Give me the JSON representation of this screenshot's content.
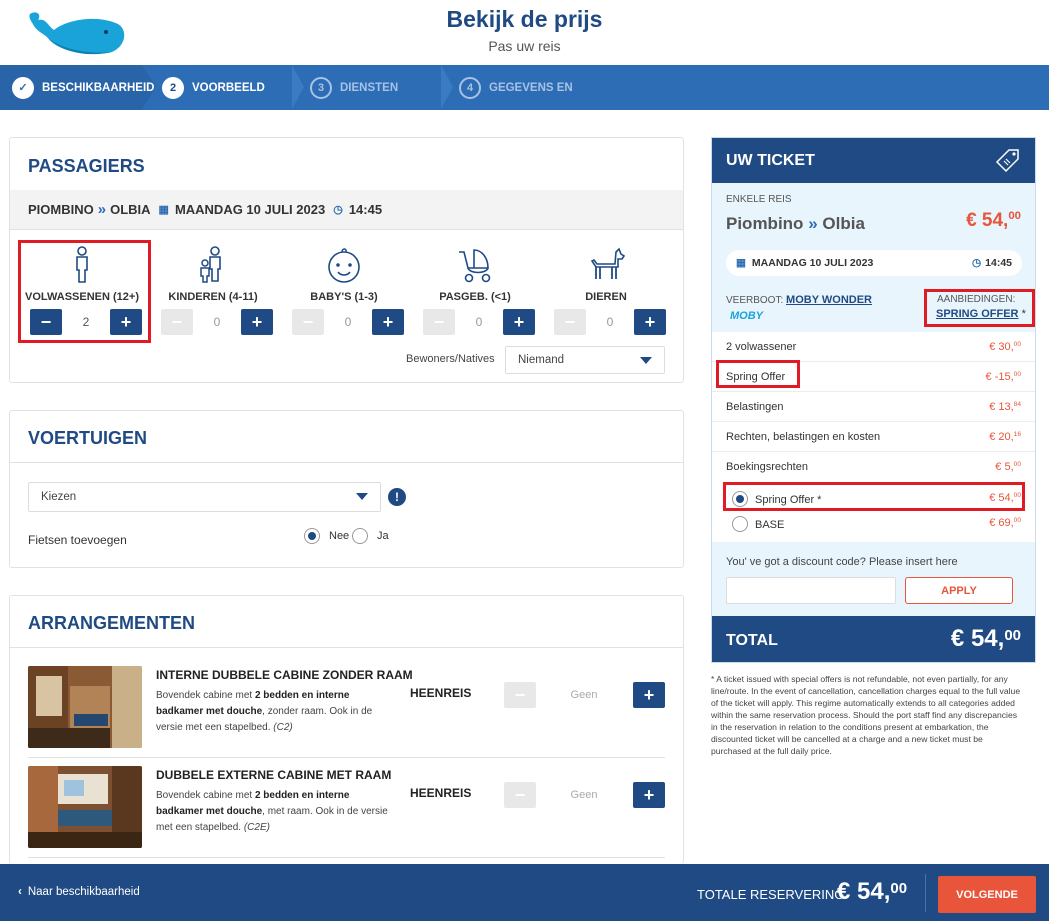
{
  "header": {
    "title": "Bekijk de prijs",
    "subtitle": "Pas uw reis"
  },
  "steps": [
    {
      "num": "✓",
      "label": "BESCHIKBAARHEID",
      "state": "done"
    },
    {
      "num": "2",
      "label": "VOORBEELD",
      "state": "active"
    },
    {
      "num": "3",
      "label": "DIENSTEN",
      "state": "todo"
    },
    {
      "num": "4",
      "label": "GEGEVENS EN",
      "state": "todo"
    }
  ],
  "passengers": {
    "title": "PASSAGIERS",
    "from": "PIOMBINO",
    "to": "OLBIA",
    "date": "MAANDAG 10 JULI 2023",
    "time": "14:45",
    "types": [
      {
        "label": "VOLWASSENEN (12+)",
        "value": "2",
        "icon": "adult-icon"
      },
      {
        "label": "KINDEREN (4-11)",
        "value": "0",
        "icon": "child-icon"
      },
      {
        "label": "BABY'S (1-3)",
        "value": "0",
        "icon": "baby-icon"
      },
      {
        "label": "PASGEB. (<1)",
        "value": "0",
        "icon": "stroller-icon"
      },
      {
        "label": "DIEREN",
        "value": "0",
        "icon": "dog-icon"
      }
    ],
    "residents_label": "Bewoners/Natives",
    "residents_value": "Niemand"
  },
  "vehicles": {
    "title": "VOERTUIGEN",
    "select_value": "Kiezen",
    "bikes_label": "Fietsen toevoegen",
    "no_label": "Nee",
    "yes_label": "Ja"
  },
  "arrangements": {
    "title": "ARRANGEMENTEN",
    "items": [
      {
        "title": "INTERNE DUBBELE CABINE ZONDER RAAM",
        "desc_1": "Bovendek cabine met ",
        "desc_2": "2 bedden en interne badkamer met douche",
        "desc_3": ", zonder raam. Ook in de versie met een stapelbed. ",
        "code": "(C2)",
        "direction": "HEENREIS",
        "value": "Geen"
      },
      {
        "title": "DUBBELE EXTERNE CABINE MET RAAM",
        "desc_1": "Bovendek cabine met ",
        "desc_2": "2 bedden en interne badkamer met douche",
        "desc_3": ", met raam. Ook in de versie met een stapelbed. ",
        "code": "(C2E)",
        "direction": "HEENREIS",
        "value": "Geen"
      }
    ]
  },
  "ticket": {
    "title": "UW TICKET",
    "trip_type": "ENKELE REIS",
    "from": "Piombino",
    "to": "Olbia",
    "price_int": "€ 54,",
    "price_dec": "00",
    "date": "MAANDAG 10 JULI 2023",
    "time": "14:45",
    "ferry_label": "VEERBOOT:",
    "ferry_name": "MOBY WONDER",
    "brand": "MOBY",
    "offers_label": "AANBIEDINGEN:",
    "offer_name": "SPRING OFFER",
    "offer_star": "*",
    "lines": [
      {
        "label": "2 volwassener",
        "int": "€ 30,",
        "dec": "00"
      },
      {
        "label": "Spring Offer",
        "int": "€ -15,",
        "dec": "00"
      },
      {
        "label": "Belastingen",
        "int": "€ 13,",
        "dec": "84"
      },
      {
        "label": "Rechten, belastingen en kosten",
        "int": "€ 20,",
        "dec": "16"
      },
      {
        "label": "Boekingsrechten",
        "int": "€ 5,",
        "dec": "00"
      }
    ],
    "options": [
      {
        "label": "Spring Offer *",
        "int": "€ 54,",
        "dec": "00",
        "selected": true
      },
      {
        "label": "BASE",
        "int": "€ 69,",
        "dec": "00",
        "selected": false
      }
    ],
    "discount_label": "You' ve got a discount code? Please insert here",
    "discount_placeholder": "",
    "apply_label": "APPLY",
    "total_label": "TOTAL",
    "total_int": "€ 54,",
    "total_dec": "00"
  },
  "disclaimer": "* A ticket issued with special offers is not refundable, not even partially, for any line/route. In the event of cancellation, cancellation charges equal to the full value of the ticket will apply. This regime automatically extends to all categories added within the same reservation process. Should the port staff find any discrepancies in the reservation in relation to the conditions present at embarkation, the discounted ticket will be cancelled at a charge and a new ticket must be purchased at the full daily price.",
  "footer": {
    "back_label": "Naar beschikbaarheid",
    "total_label": "TOTALE RESERVERING",
    "total_int": "€ 54,",
    "total_dec": "00",
    "next_label": "VOLGENDE"
  },
  "colors": {
    "navy": "#1f4a83",
    "blue": "#2d6db5",
    "orange": "#e8553a",
    "highlight": "#e01b24",
    "ticket_bg": "#e9f5fd"
  }
}
